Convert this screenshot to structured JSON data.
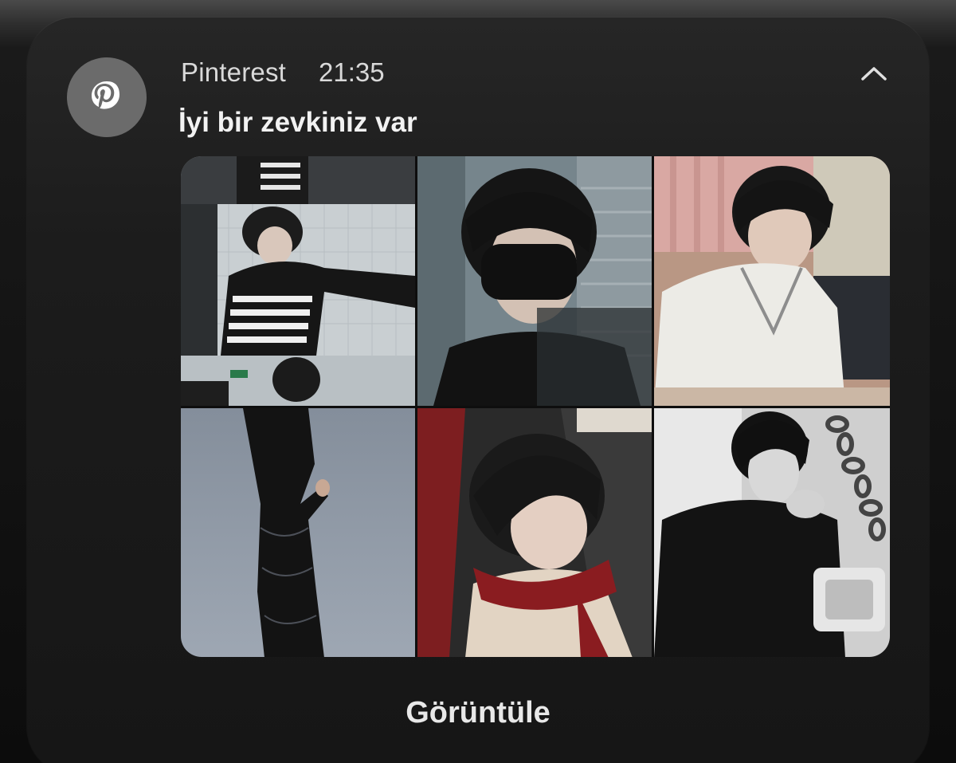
{
  "notification": {
    "app_name": "Pinterest",
    "time": "21:35",
    "title": "İyi bir zevkiniz var",
    "action_label": "Görüntüle",
    "app_icon": "pinterest-logo-icon",
    "collapse_icon": "chevron-up-icon"
  },
  "images": [
    {
      "name": "pin-image-1",
      "palette": [
        "#9aa2a6",
        "#2b2b2b",
        "#dcdcdc"
      ]
    },
    {
      "name": "pin-image-2",
      "palette": [
        "#6e7c83",
        "#111111",
        "#c8b8ad"
      ]
    },
    {
      "name": "pin-image-3",
      "palette": [
        "#d9a7a2",
        "#ecebe6",
        "#1c1c1c"
      ]
    },
    {
      "name": "pin-image-4",
      "palette": [
        "#8b95a3",
        "#141414",
        "#a7afbb"
      ]
    },
    {
      "name": "pin-image-5",
      "palette": [
        "#6d1c1e",
        "#1a1a1a",
        "#d8c6b4"
      ]
    },
    {
      "name": "pin-image-6",
      "palette": [
        "#9a9a9a",
        "#111111",
        "#e6e6e6"
      ]
    }
  ],
  "colors": {
    "card_background": "#1c1c1c",
    "icon_background": "#6b6b6b",
    "text_primary": "#f2f2f2",
    "text_secondary": "#d9d9d9"
  }
}
